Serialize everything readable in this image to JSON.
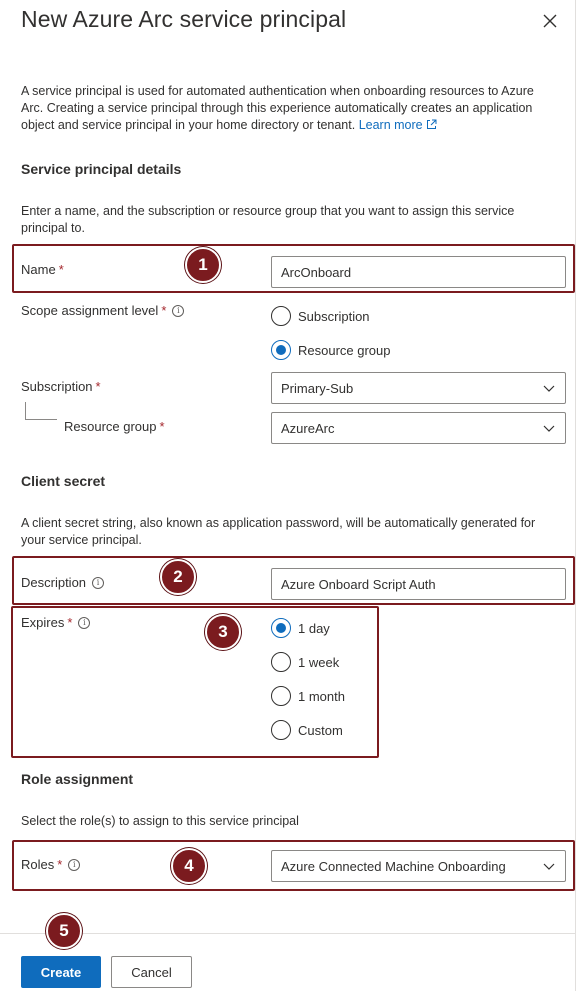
{
  "header": {
    "title": "New Azure Arc service principal"
  },
  "intro": {
    "text": "A service principal is used for automated authentication when onboarding resources to Azure Arc. Creating a service principal through this experience automatically creates an application object and service principal in your home directory or tenant.",
    "learn_more": "Learn more"
  },
  "details": {
    "heading": "Service principal details",
    "description": "Enter a name, and the subscription or resource group that you want to assign this service principal to.",
    "name_label": "Name",
    "name_value": "ArcOnboard",
    "scope_label": "Scope assignment level",
    "scope_options": [
      "Subscription",
      "Resource group"
    ],
    "scope_selected": "Resource group",
    "subscription_label": "Subscription",
    "subscription_value": "Primary-Sub",
    "resource_group_label": "Resource group",
    "resource_group_value": "AzureArc"
  },
  "secret": {
    "heading": "Client secret",
    "description": "A client secret string, also known as application password, will be automatically generated for your service principal.",
    "description_label": "Description",
    "description_value": "Azure Onboard Script Auth",
    "expires_label": "Expires",
    "expires_options": [
      "1 day",
      "1 week",
      "1 month",
      "Custom"
    ],
    "expires_selected": "1 day"
  },
  "roles": {
    "heading": "Role assignment",
    "description": "Select the role(s) to assign to this service principal",
    "roles_label": "Roles",
    "roles_value": "Azure Connected Machine Onboarding"
  },
  "callouts": [
    "1",
    "2",
    "3",
    "4",
    "5"
  ],
  "footer": {
    "create_label": "Create",
    "cancel_label": "Cancel"
  },
  "colors": {
    "accent": "#0f6cbd",
    "callout": "#7b1b1f",
    "required": "#a4262c"
  },
  "icons": [
    "close-icon",
    "info-icon",
    "external-link-icon",
    "chevron-down-icon"
  ],
  "required_marker": "*",
  "info_glyph": "i"
}
